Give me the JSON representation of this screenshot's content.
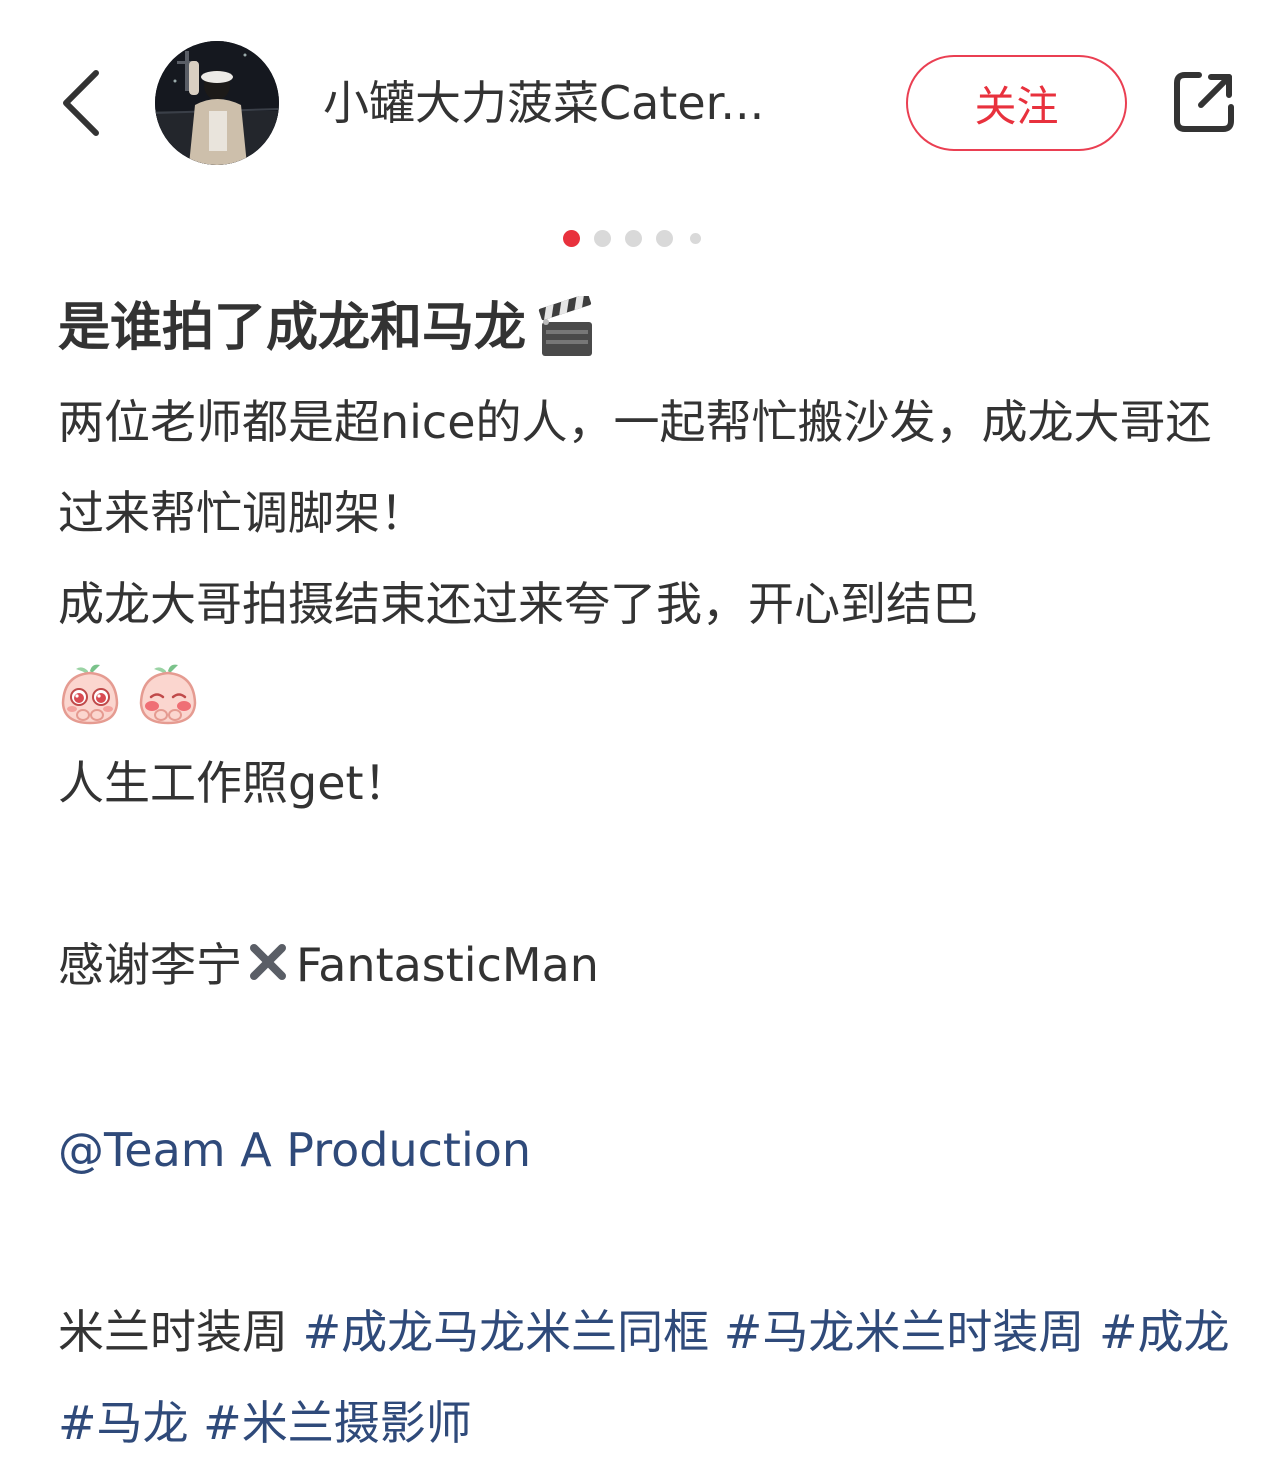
{
  "header": {
    "author_name": "小罐大力菠菜Cater...",
    "follow_label": "关注"
  },
  "carousel": {
    "total": 5,
    "active_index": 0
  },
  "note": {
    "title": "是谁拍了成龙和马龙",
    "body_line_1": "两位老师都是超nice的人，一起帮忙搬沙发，成龙大哥还过来帮忙调脚架！",
    "body_line_2": "成龙大哥拍摄结束还过来夸了我，开心到结巴",
    "body_line_3": "人生工作照get！",
    "thanks_prefix": "感谢李宁",
    "thanks_suffix": "FantasticMan",
    "mention": "@Team A Production",
    "tags_prefix": "米兰时装周",
    "tags": [
      "#成龙马龙米兰同框",
      "#马龙米兰时装周",
      "#成龙",
      "#马龙",
      "#米兰摄影师"
    ]
  },
  "colors": {
    "accent_red": "#e8313d",
    "link_blue": "#2f4a7a",
    "text": "#333333"
  },
  "icons": [
    "back-arrow-icon",
    "share-external-icon",
    "clapperboard-emoji",
    "peach-pleading-emoji",
    "peach-shy-emoji",
    "heavy-x-emoji"
  ]
}
